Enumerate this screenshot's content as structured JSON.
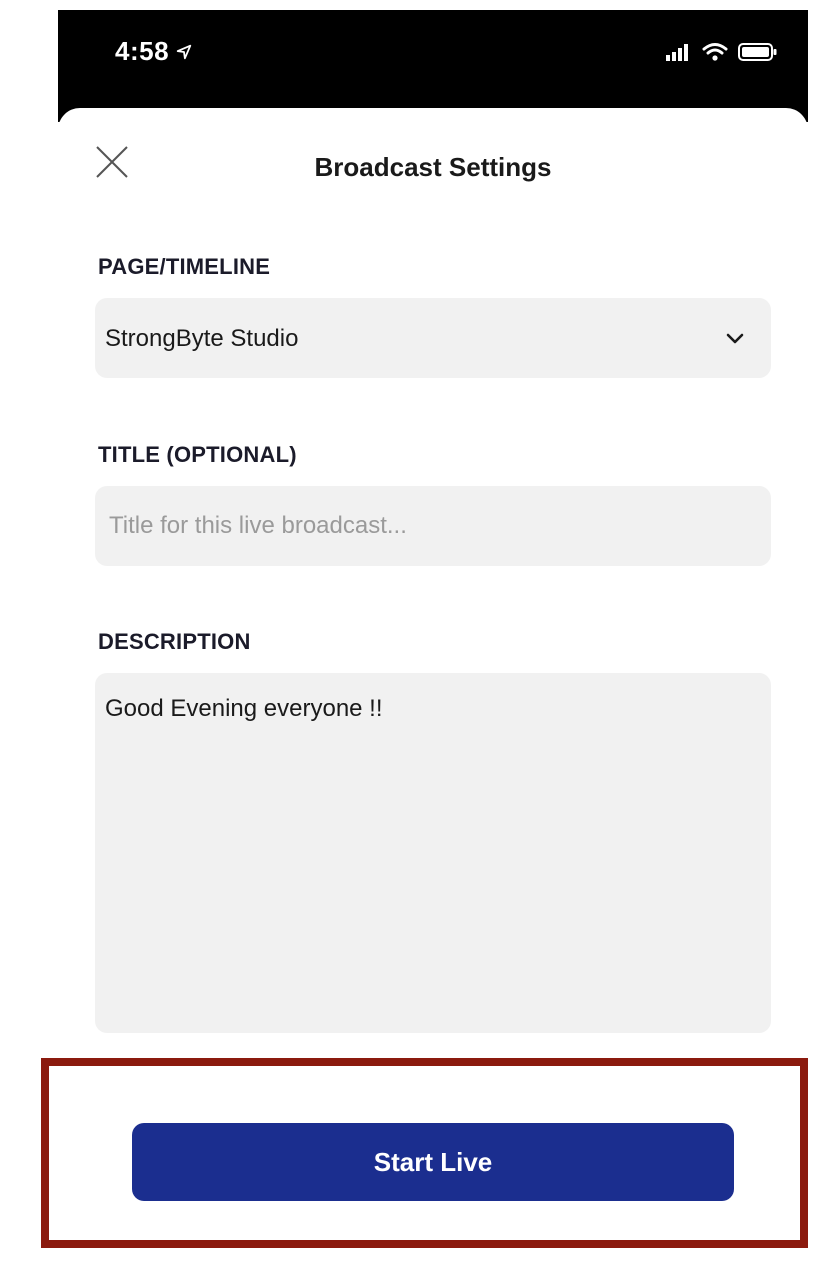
{
  "status_bar": {
    "time": "4:58"
  },
  "sheet": {
    "title": "Broadcast Settings"
  },
  "fields": {
    "page_timeline": {
      "label": "PAGE/TIMELINE",
      "value": "StrongByte Studio"
    },
    "title": {
      "label": "TITLE (OPTIONAL)",
      "placeholder": "Title for this live broadcast...",
      "value": ""
    },
    "description": {
      "label": "DESCRIPTION",
      "value": "Good Evening everyone !!"
    }
  },
  "actions": {
    "start_label": "Start Live"
  },
  "colors": {
    "primary_button": "#1b2e8f",
    "highlight_border": "#8b1a0e",
    "field_background": "#f1f1f1"
  },
  "icons": [
    "location-arrow-icon",
    "cellular-signal-icon",
    "wifi-icon",
    "battery-icon",
    "close-icon",
    "chevron-down-icon"
  ]
}
